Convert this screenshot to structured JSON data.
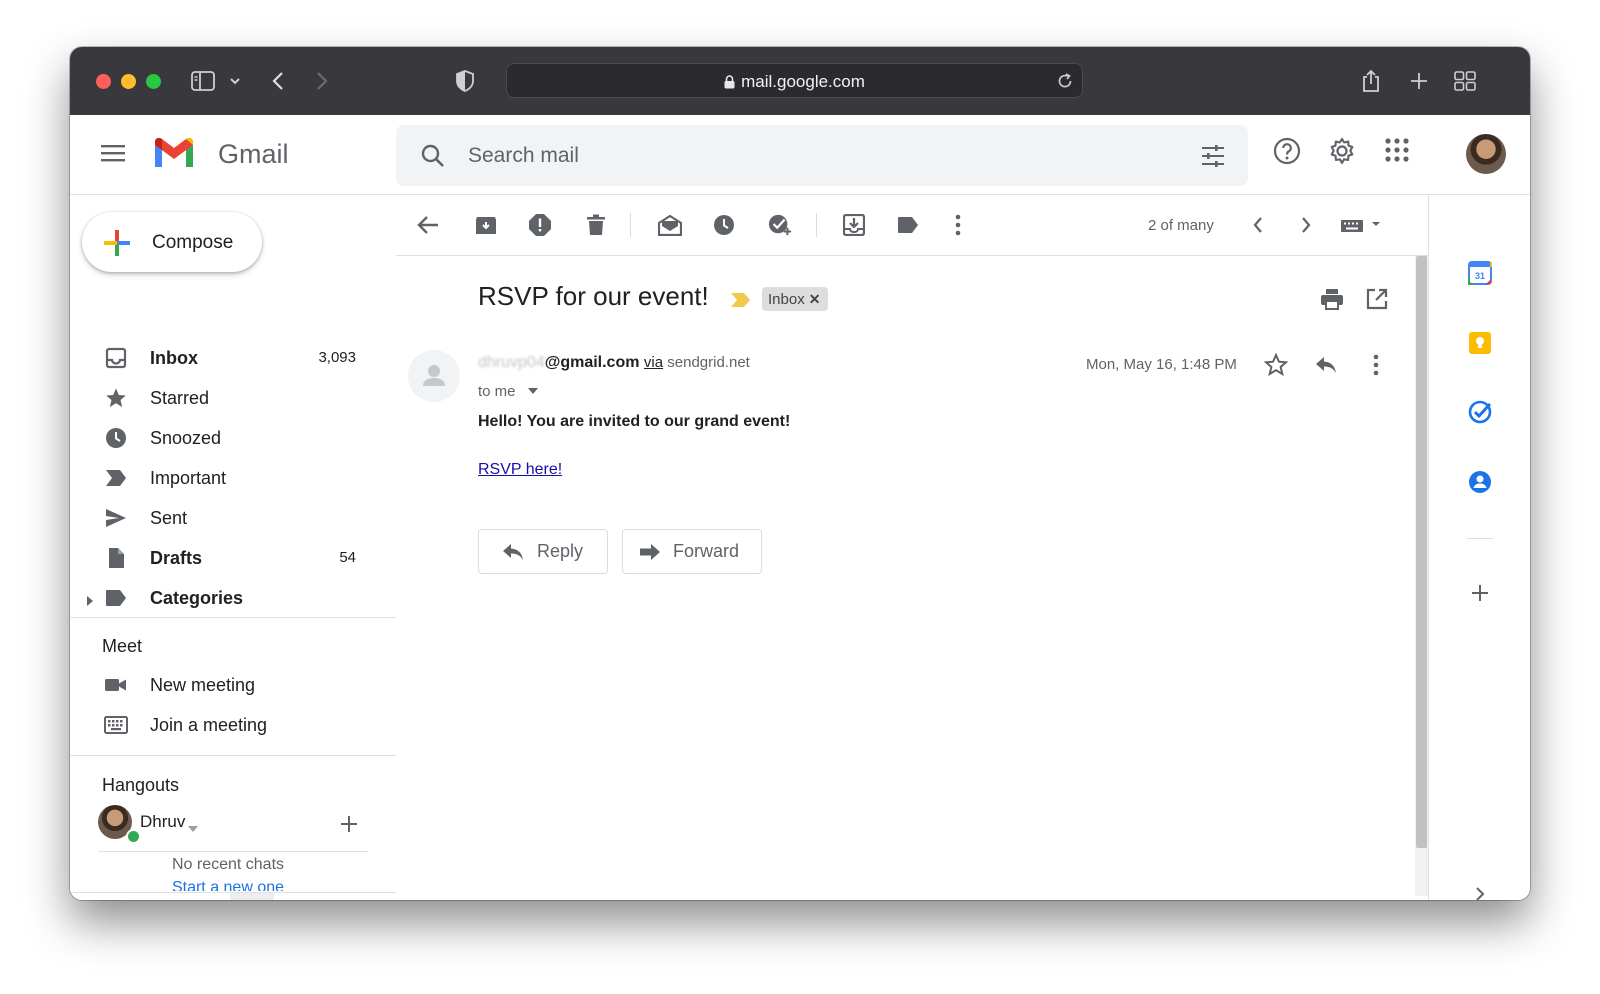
{
  "browser": {
    "url": "mail.google.com"
  },
  "header": {
    "app_name": "Gmail",
    "search_placeholder": "Search mail"
  },
  "sidebar": {
    "compose_label": "Compose",
    "items": [
      {
        "label": "Inbox",
        "count": "3,093",
        "bold": true,
        "icon": "inbox-icon"
      },
      {
        "label": "Starred",
        "count": "",
        "bold": false,
        "icon": "star-icon"
      },
      {
        "label": "Snoozed",
        "count": "",
        "bold": false,
        "icon": "clock-icon"
      },
      {
        "label": "Important",
        "count": "",
        "bold": false,
        "icon": "important-icon"
      },
      {
        "label": "Sent",
        "count": "",
        "bold": false,
        "icon": "send-icon"
      },
      {
        "label": "Drafts",
        "count": "54",
        "bold": true,
        "icon": "draft-icon"
      },
      {
        "label": "Categories",
        "count": "",
        "bold": true,
        "icon": "label-icon"
      }
    ],
    "meet": {
      "title": "Meet",
      "new_meeting": "New meeting",
      "join_meeting": "Join a meeting"
    },
    "hangouts": {
      "title": "Hangouts",
      "user": "Dhruv",
      "no_chats": "No recent chats",
      "start_new": "Start a new one"
    }
  },
  "toolbar": {
    "pager": "2 of many"
  },
  "message": {
    "subject": "RSVP for our event!",
    "label": "Inbox",
    "sender_hidden": "dhruvp04",
    "sender_email": "@gmail.com",
    "via_word": "via",
    "via_domain": "sendgrid.net",
    "to": "to me",
    "date": "Mon, May 16, 1:48 PM",
    "body": "Hello! You are invited to our grand event!",
    "link_text": "RSVP here!",
    "reply_label": "Reply",
    "forward_label": "Forward"
  },
  "side_panel": {
    "calendar_day": "31"
  },
  "colors": {
    "gmail_red": "#ea4335",
    "gmail_blue": "#4285f4",
    "gmail_green": "#34a853",
    "gmail_yellow": "#fbbc04",
    "link": "#1a0dab",
    "chrome_dark": "#38383d"
  }
}
